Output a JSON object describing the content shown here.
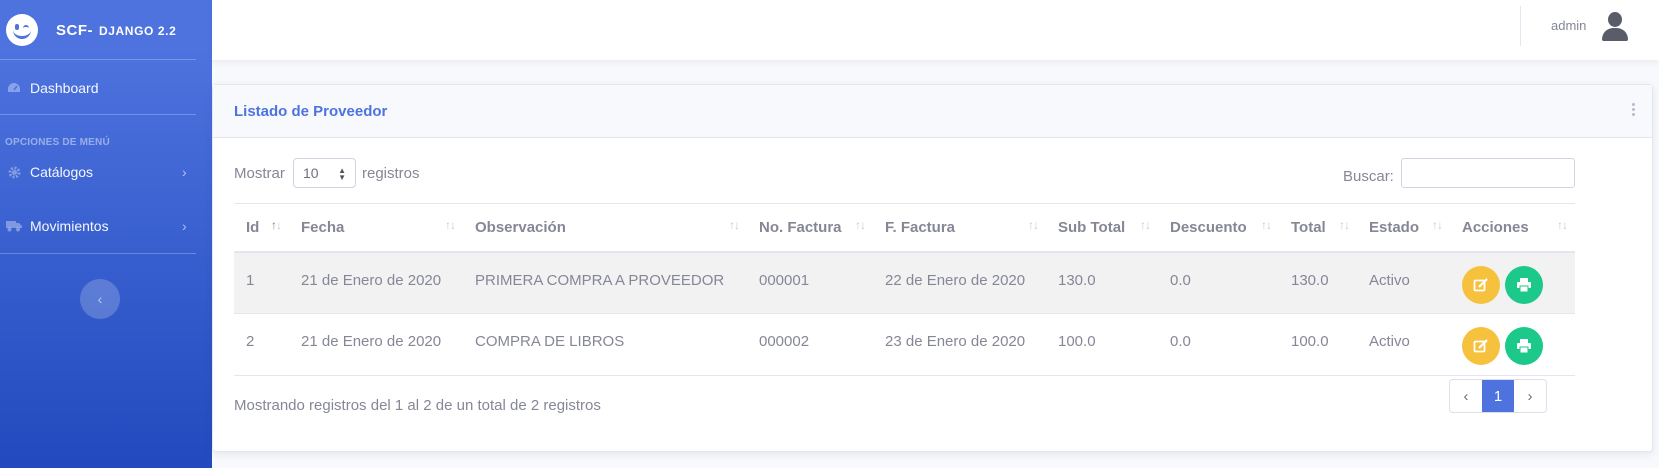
{
  "brand": {
    "name": "SCF-",
    "sub": "DJANGO 2.2"
  },
  "sidebar": {
    "dashboard": {
      "label": "Dashboard",
      "icon": "tachometer-icon"
    },
    "heading": "OPCIONES DE MENÚ",
    "items": [
      {
        "label": "Catálogos",
        "icon": "cog-icon"
      },
      {
        "label": "Movimientos",
        "icon": "truck-icon"
      }
    ],
    "toggle_icon": "chevron-left-icon"
  },
  "topbar": {
    "username": "admin",
    "avatar_icon": "user-icon"
  },
  "card": {
    "title": "Listado de Proveedor",
    "menu_icon": "ellipsis-vertical-icon"
  },
  "controls": {
    "show_label": "Mostrar",
    "length_value": "10",
    "records_label": "registros",
    "search_label": "Buscar:",
    "search_value": ""
  },
  "table": {
    "columns": [
      "Id",
      "Fecha",
      "Observación",
      "No. Factura",
      "F. Factura",
      "Sub Total",
      "Descuento",
      "Total",
      "Estado",
      "Acciones"
    ],
    "rows": [
      {
        "id": "1",
        "fecha": "21 de Enero de 2020",
        "observacion": "PRIMERA COMPRA A PROVEEDOR",
        "no_factura": "000001",
        "f_factura": "22 de Enero de 2020",
        "sub_total": "130.0",
        "descuento": "0.0",
        "total": "130.0",
        "estado": "Activo"
      },
      {
        "id": "2",
        "fecha": "21 de Enero de 2020",
        "observacion": "COMPRA DE LIBROS",
        "no_factura": "000002",
        "f_factura": "23 de Enero de 2020",
        "sub_total": "100.0",
        "descuento": "0.0",
        "total": "100.0",
        "estado": "Activo"
      }
    ]
  },
  "footer": {
    "info": "Mostrando registros del 1 al 2 de un total de 2 registros",
    "pagination": {
      "prev": "‹",
      "current": "1",
      "next": "›"
    }
  },
  "colors": {
    "primary": "#4e73df",
    "warning": "#f6c23e",
    "success": "#1cc88a",
    "text": "#858796"
  }
}
